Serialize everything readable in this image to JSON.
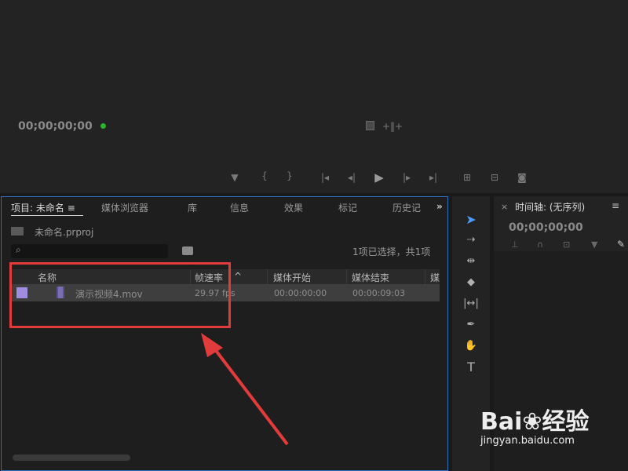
{
  "monitor": {
    "timecode": "00;00;00;00",
    "controls": [
      "marker-icon",
      "mark-in-icon",
      "mark-out-icon",
      "go-to-in-icon",
      "step-back-icon",
      "play-icon",
      "step-forward-icon",
      "go-to-out-icon",
      "insert-icon",
      "overwrite-icon",
      "camera-icon"
    ]
  },
  "project": {
    "tabs": [
      "项目: 未命名",
      "媒体浏览器",
      "库",
      "信息",
      "效果",
      "标记",
      "历史记"
    ],
    "menu_icon": "≡",
    "overflow_icon": "»",
    "project_file": "未命名.prproj",
    "selection_status": "1项已选择，共1项",
    "columns": [
      "名称",
      "帧速率",
      "媒体开始",
      "媒体结束",
      "媒"
    ],
    "rows": [
      {
        "name": "演示视频4.mov",
        "frame_rate": "29.97 fps",
        "media_start": "00:00:00:00",
        "media_end": "00:00:09:03"
      }
    ]
  },
  "timeline": {
    "close": "×",
    "title": "时间轴: (无序列)",
    "menu_icon": "≡",
    "timecode": "00;00;00;00"
  },
  "tools": [
    "selection-tool",
    "track-select-tool",
    "ripple-edit-tool",
    "razor-tool",
    "slip-tool",
    "pen-tool",
    "hand-tool",
    "type-tool"
  ],
  "watermark": {
    "brand": "Bai",
    "brand2": "经验",
    "url": "jingyan.baidu.com"
  },
  "colors": {
    "accent": "#2d6dbd",
    "annotation": "#e23b3b",
    "label_violet": "#a18de0"
  }
}
